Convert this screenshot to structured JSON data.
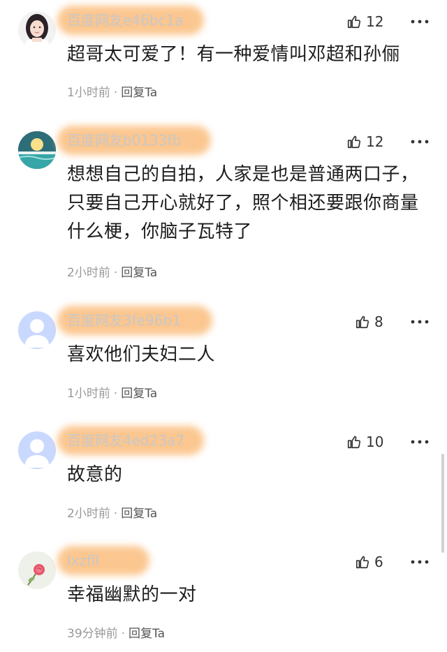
{
  "comments": [
    {
      "username": "百度网友e46bc1a",
      "likes": "12",
      "text": "超哥太可爱了！有一种爱情叫邓超和孙俪",
      "time": "1小时前",
      "reply": "回复Ta",
      "avatar": "photo-avatar"
    },
    {
      "username": "百度网友b0133fb",
      "likes": "12",
      "text": "想想自己的自拍，人家是也是普通两口子，只要自己开心就好了，照个相还要跟你商量什么梗，你脑子瓦特了",
      "time": "2小时前",
      "reply": "回复Ta",
      "avatar": "sunset-avatar"
    },
    {
      "username": "百度网友3fe96b1",
      "likes": "8",
      "text": "喜欢他们夫妇二人",
      "time": "1小时前",
      "reply": "回复Ta",
      "avatar": "default-avatar"
    },
    {
      "username": "百度网友4ed23a7",
      "likes": "10",
      "text": "故意的",
      "time": "2小时前",
      "reply": "回复Ta",
      "avatar": "default-avatar"
    },
    {
      "username": "lxzfll",
      "likes": "6",
      "text": "幸福幽默的一对",
      "time": "39分钟前",
      "reply": "回复Ta",
      "avatar": "rose-avatar"
    }
  ],
  "colors": {
    "text": "#1c1c1c",
    "meta": "#999999",
    "reply": "#555555",
    "blur": "#fbc48a",
    "default_avatar": "#c9d8ff"
  }
}
